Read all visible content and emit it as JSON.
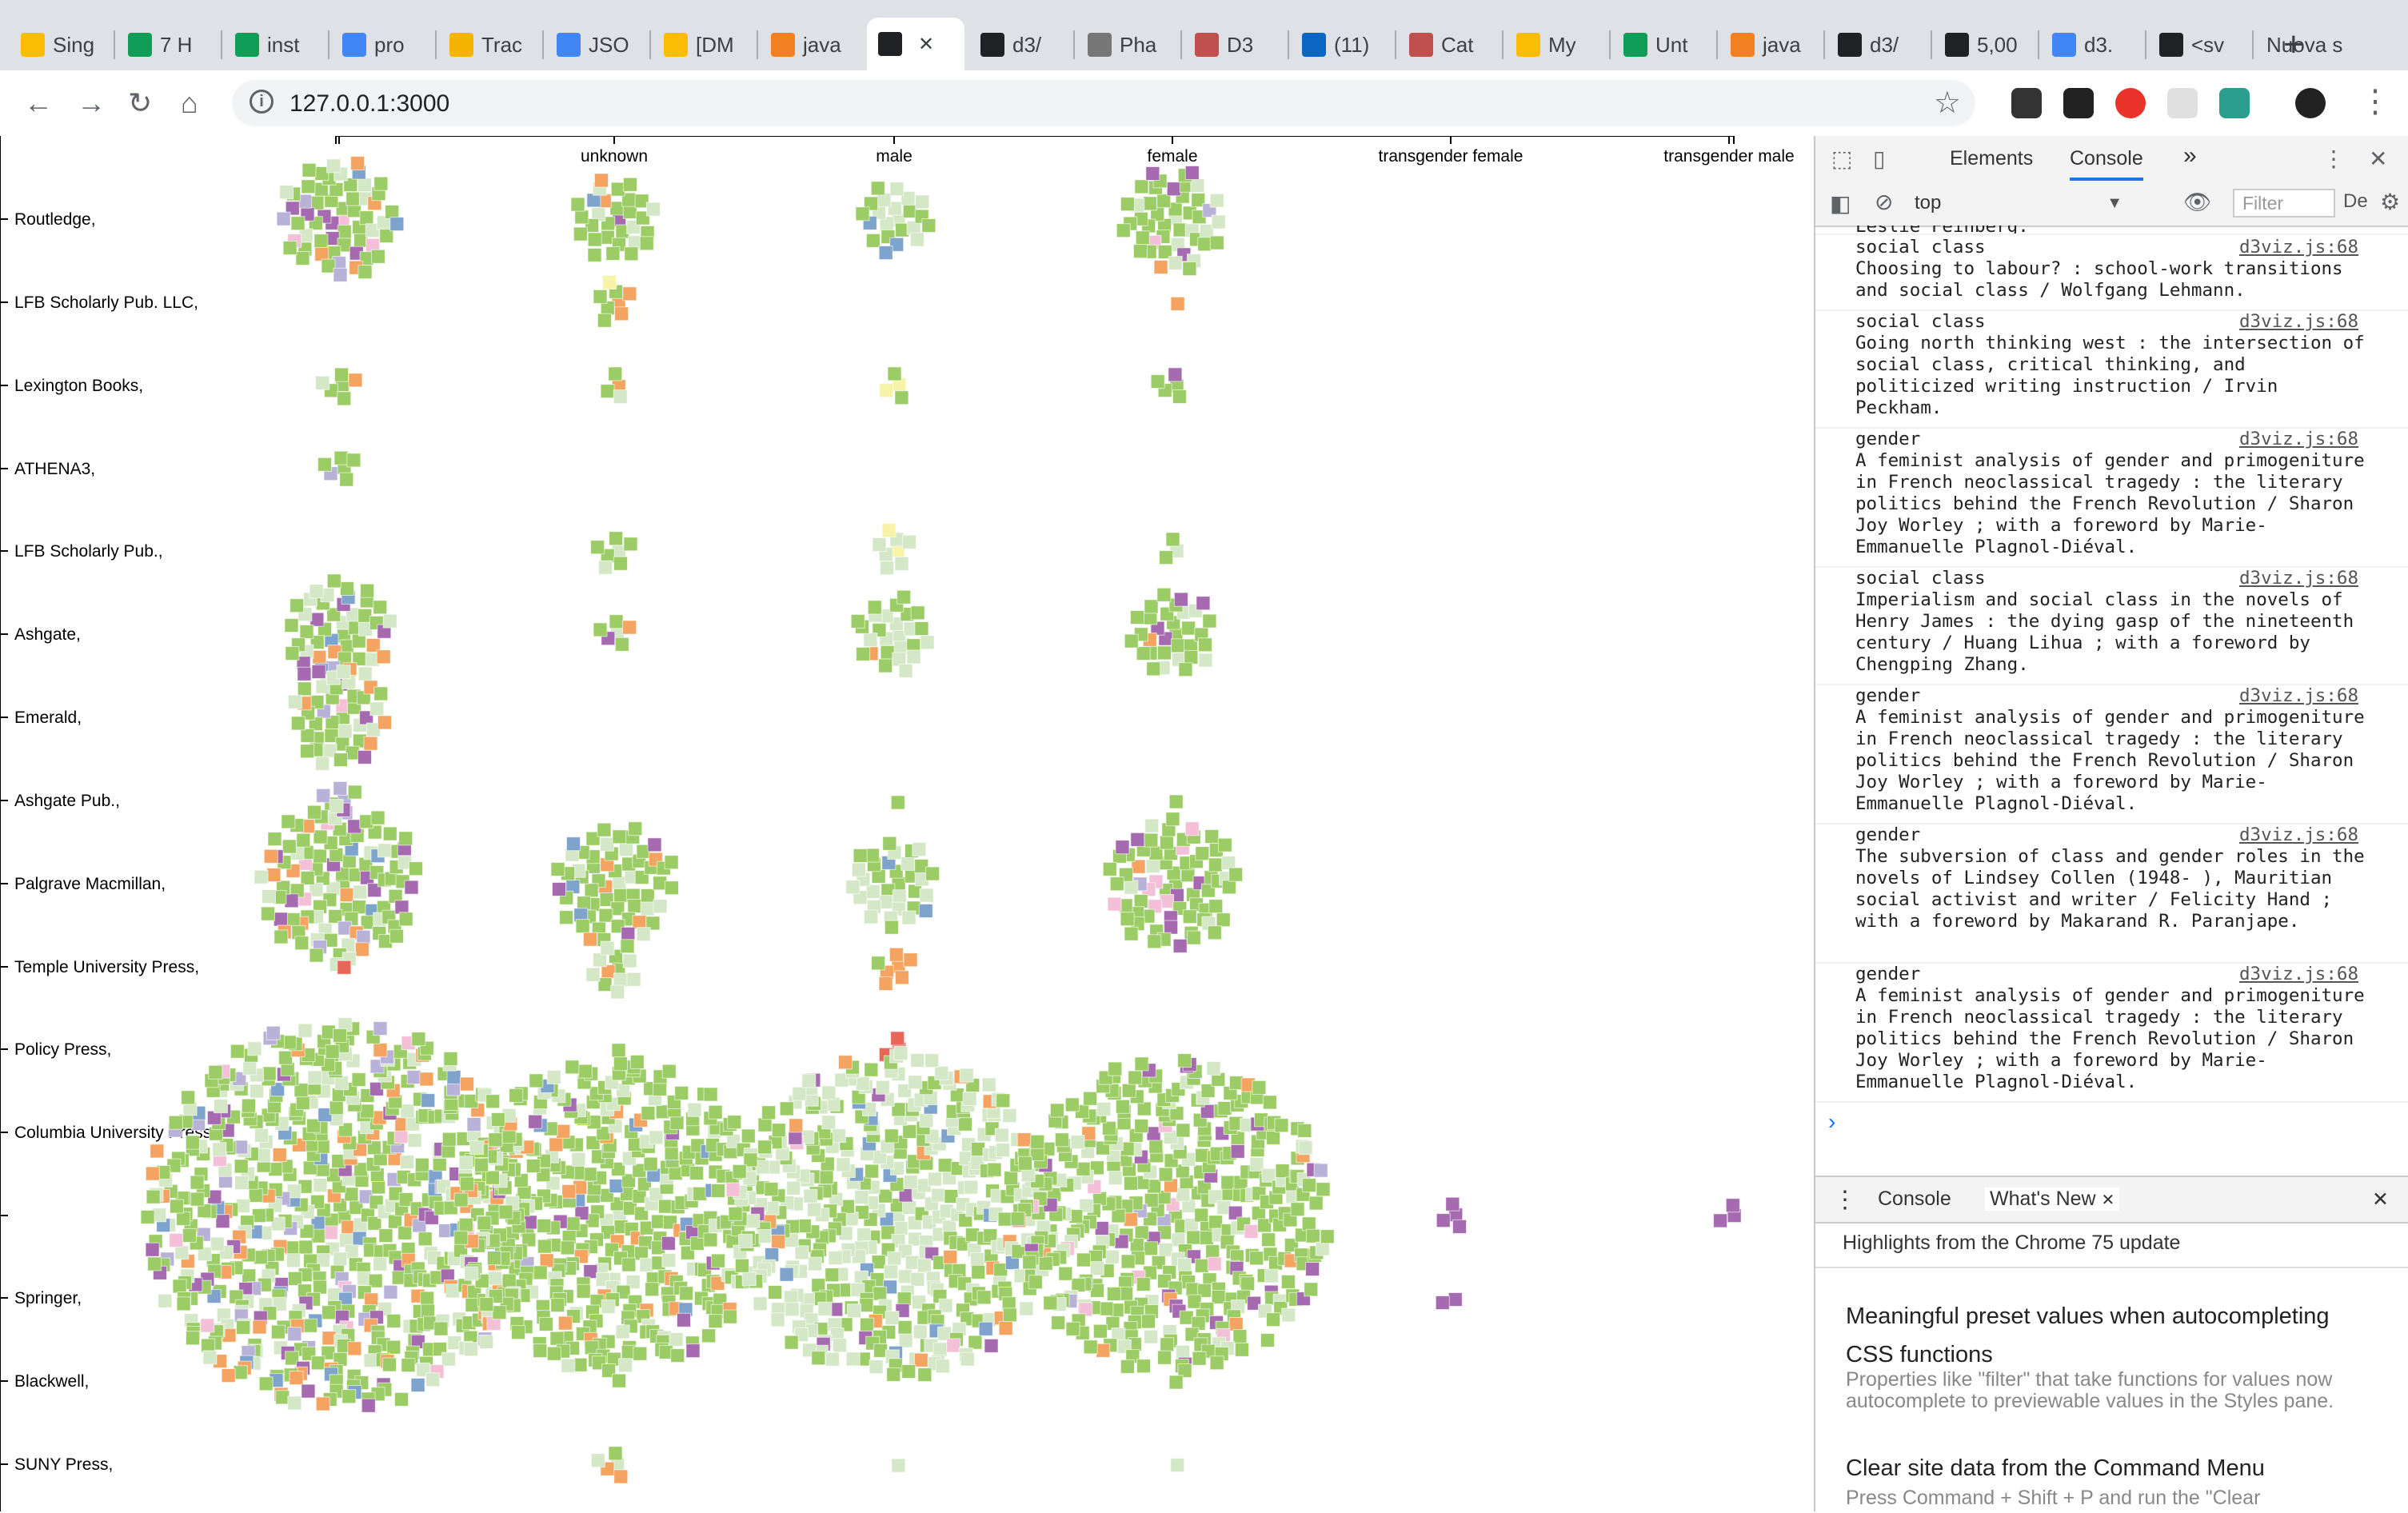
{
  "browser": {
    "tabs": [
      {
        "label": "Sing",
        "color": "#fbbc04"
      },
      {
        "label": "7 H",
        "color": "#0f9d58"
      },
      {
        "label": "inst",
        "color": "#0f9d58"
      },
      {
        "label": "pro",
        "color": "#4285f4"
      },
      {
        "label": "Trac",
        "color": "#f4b400"
      },
      {
        "label": "JSO",
        "color": "#4285f4"
      },
      {
        "label": "[DM",
        "color": "#fbbc04"
      },
      {
        "label": "java",
        "color": "#f48024"
      },
      {
        "label": "",
        "color": "#202124"
      },
      {
        "label": "d3/",
        "color": "#202124"
      },
      {
        "label": "Pha",
        "color": "#777777"
      },
      {
        "label": "D3",
        "color": "#c0504d"
      },
      {
        "label": "(11)",
        "color": "#0a66c2"
      },
      {
        "label": "Cat",
        "color": "#c0504d"
      },
      {
        "label": "My",
        "color": "#fbbc04"
      },
      {
        "label": "Unt",
        "color": "#0f9d58"
      },
      {
        "label": "java",
        "color": "#f48024"
      },
      {
        "label": "d3/",
        "color": "#202124"
      },
      {
        "label": "5,00",
        "color": "#202124"
      },
      {
        "label": "d3.",
        "color": "#4285f4"
      },
      {
        "label": "<sv",
        "color": "#202124"
      },
      {
        "label": "Nuova s",
        "color": "#ffffff"
      }
    ],
    "active_tab_index": 8,
    "url": "127.0.0.1:3000"
  },
  "chart_data": {
    "type": "scatter",
    "columns": [
      "",
      "unknown",
      "male",
      "female",
      "transgender female",
      "transgender male"
    ],
    "rows": [
      "Routledge,",
      "LFB Scholarly Pub. LLC,",
      "Lexington Books,",
      "ATHENA3,",
      "LFB Scholarly Pub.,",
      "Ashgate,",
      "Emerald,",
      "Ashgate Pub.,",
      "Palgrave Macmillan,",
      "Temple University Press,",
      "Policy Press,",
      "Columbia University Press,",
      "",
      "Springer,",
      "Blackwell,",
      "SUNY Press,"
    ],
    "colors": {
      "green": "#9ccc65",
      "light_green": "#d4e8c8",
      "orange": "#f4a460",
      "purple": "#a66ab0",
      "lavender": "#b8b2d8",
      "blue": "#7ea3cc",
      "pink": "#f4c0d8",
      "red": "#e8675a",
      "yellow": "#f7f3a8"
    }
  },
  "devtools": {
    "tabs": [
      "Elements",
      "Console"
    ],
    "active_tab": "Console",
    "more": "»",
    "context": "top",
    "filter_placeholder": "Filter",
    "levels": "De",
    "partial_line": "Leslie Feinberg.",
    "messages": [
      {
        "cat": "social class",
        "src": "d3viz.js:68",
        "text": "Choosing to labour? : school-work transitions and social class / Wolfgang Lehmann."
      },
      {
        "cat": "social class",
        "src": "d3viz.js:68",
        "text": "Going north thinking west : the intersection of social class, critical thinking, and politicized writing instruction / Irvin Peckham."
      },
      {
        "cat": "gender",
        "src": "d3viz.js:68",
        "text": "A feminist analysis of gender and primogeniture in French neoclassical tragedy : the literary politics behind the French Revolution / Sharon Joy Worley ; with a foreword by Marie-Emmanuelle Plagnol-Diéval."
      },
      {
        "cat": "social class",
        "src": "d3viz.js:68",
        "text": "Imperialism and social class in the novels of Henry James : the dying gasp of the nineteenth century / Huang Lihua ; with a foreword by Chengping Zhang."
      },
      {
        "cat": "gender",
        "src": "d3viz.js:68",
        "text": "A feminist analysis of gender and primogeniture in French neoclassical tragedy : the literary politics behind the French Revolution / Sharon Joy Worley ; with a foreword by Marie-Emmanuelle Plagnol-Diéval."
      },
      {
        "cat": "gender",
        "src": "d3viz.js:68",
        "text": "The subversion of class and gender roles in the novels of Lindsey Collen (1948- ), Mauritian social activist and writer / Felicity Hand ; with a foreword by Makarand R. Paranjape."
      },
      {
        "cat": "gender",
        "src": "d3viz.js:68",
        "text": "A feminist analysis of gender and primogeniture in French neoclassical tragedy : the literary politics behind the French Revolution / Sharon Joy Worley ; with a foreword by Marie-Emmanuelle Plagnol-Diéval."
      }
    ],
    "prompt": "›",
    "drawer": {
      "tabs": [
        "Console",
        "What's New"
      ],
      "active": "What's New",
      "close_tab": "✕",
      "heading": "Highlights from the Chrome 75 update",
      "items": [
        {
          "title": "Meaningful preset values when autocompleting CSS functions",
          "desc": "Properties like \"filter\" that take functions for values now autocomplete to previewable values in the Styles pane."
        },
        {
          "title": "Clear site data from the Command Menu",
          "desc": "Press Command + Shift + P and run the \"Clear"
        }
      ]
    }
  }
}
